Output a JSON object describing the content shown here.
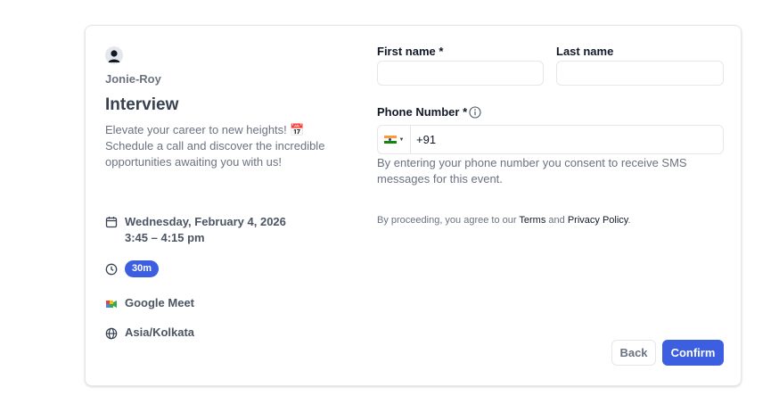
{
  "organizer": {
    "name": "Jonie-Roy"
  },
  "event": {
    "title": "Interview",
    "description": "Elevate your career to new heights! 📅 Schedule a call and discover the incredible opportunities awaiting you with us!",
    "date": "Wednesday, February 4, 2026",
    "time_range": "3:45 – 4:15 pm",
    "duration": "30m",
    "location": "Google Meet",
    "timezone": "Asia/Kolkata"
  },
  "form": {
    "first_name_label": "First name *",
    "first_name_value": "",
    "last_name_label": "Last name",
    "last_name_value": "",
    "phone_label": "Phone Number *",
    "phone_country": "India",
    "phone_value": "+91",
    "consent_text": "By entering your phone number you consent to receive SMS messages for this event.",
    "terms_prefix": "By proceeding, you agree to our ",
    "terms_link": "Terms",
    "terms_and": " and ",
    "privacy_link": "Privacy Policy",
    "terms_suffix": "."
  },
  "buttons": {
    "back_label": "Back",
    "confirm_label": "Confirm"
  },
  "colors": {
    "accent": "#3b5fe0",
    "muted_text": "#6b7280",
    "border": "#e5e7eb"
  },
  "icons": {
    "avatar": "user-avatar-icon",
    "calendar": "calendar-icon",
    "clock": "clock-icon",
    "video": "google-meet-icon",
    "globe": "globe-icon",
    "info": "info-icon",
    "flag": "india-flag-icon"
  }
}
